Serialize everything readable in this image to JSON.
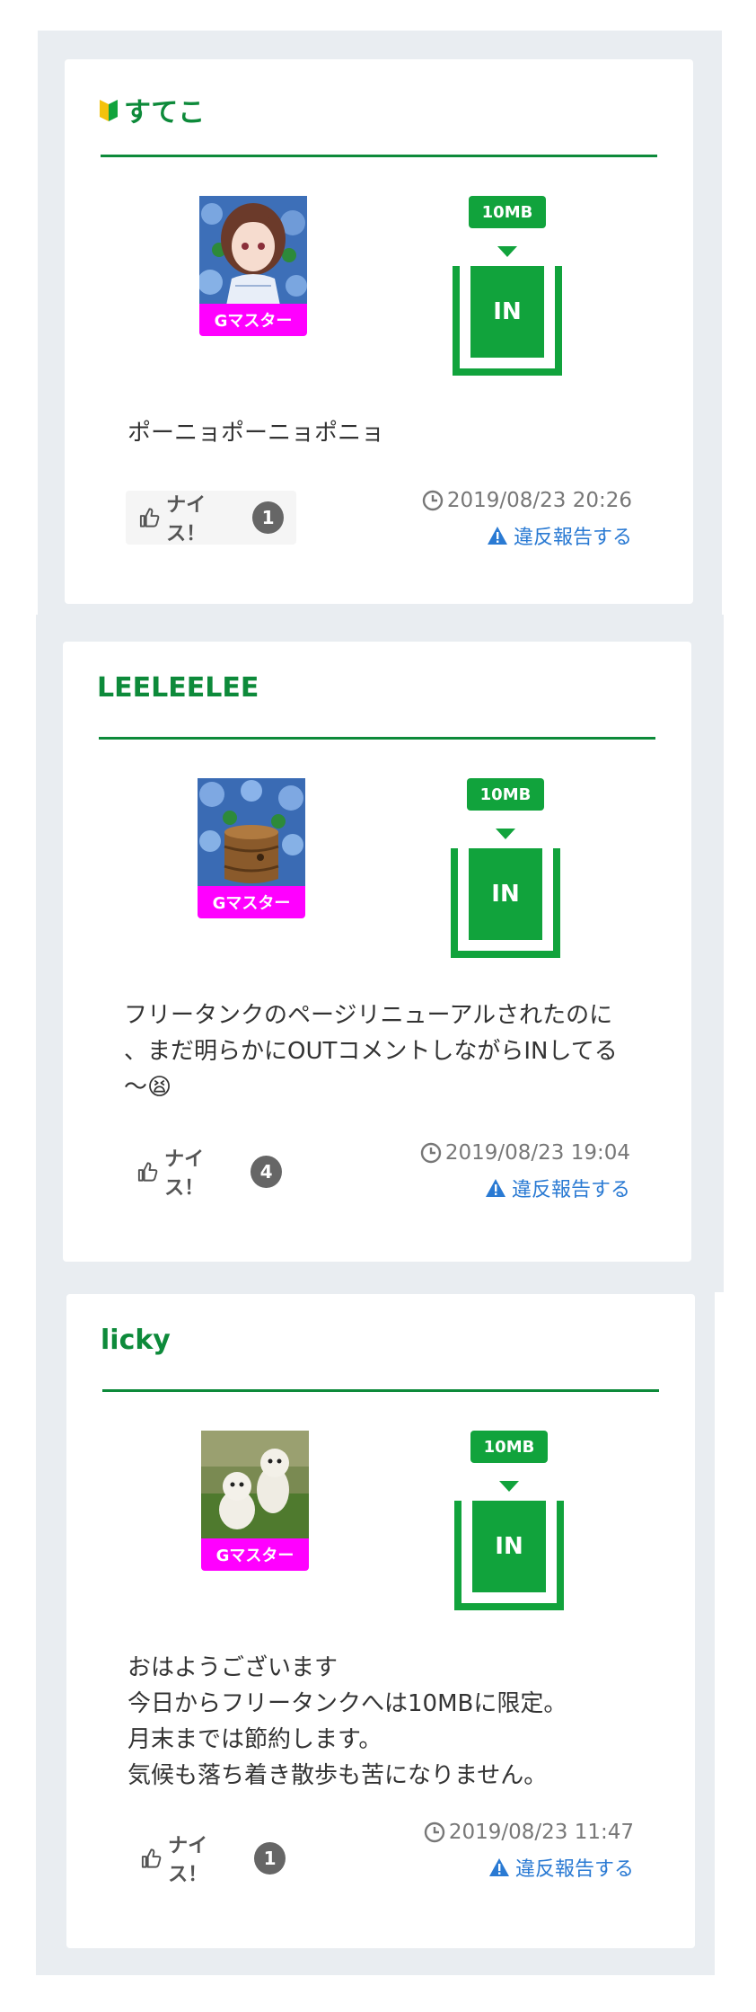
{
  "colors": {
    "brand_green": "#0d8a3a",
    "tank_green": "#11a33c",
    "rank_magenta": "#ff00ff",
    "link_blue": "#2a7ad3"
  },
  "posts": [
    {
      "username": "すてこ",
      "beginner_mark": true,
      "rank": "Gマスター",
      "badge": "10MB",
      "direction": "IN",
      "comment": "ポーニョポーニョポニョ",
      "nice_label": "ナイス！",
      "nice_count": "1",
      "timestamp": "2019/08/23 20:26",
      "report_label": "違反報告する"
    },
    {
      "username": "LEELEELEE",
      "beginner_mark": false,
      "rank": "Gマスター",
      "badge": "10MB",
      "direction": "IN",
      "comment": "フリータンクのページリニューアルされたのに\n、まだ明らかにOUTコメントしながらINしてる\n〜😫",
      "nice_label": "ナイス！",
      "nice_count": "4",
      "timestamp": "2019/08/23 19:04",
      "report_label": "違反報告する"
    },
    {
      "username": "licky",
      "beginner_mark": false,
      "rank": "Gマスター",
      "badge": "10MB",
      "direction": "IN",
      "comment": "おはようございます\n今日からフリータンクへは10MBに限定。\n月末までは節約します。\n気候も落ち着き散歩も苦になりません。",
      "nice_label": "ナイス！",
      "nice_count": "1",
      "timestamp": "2019/08/23 11:47",
      "report_label": "違反報告する"
    }
  ]
}
